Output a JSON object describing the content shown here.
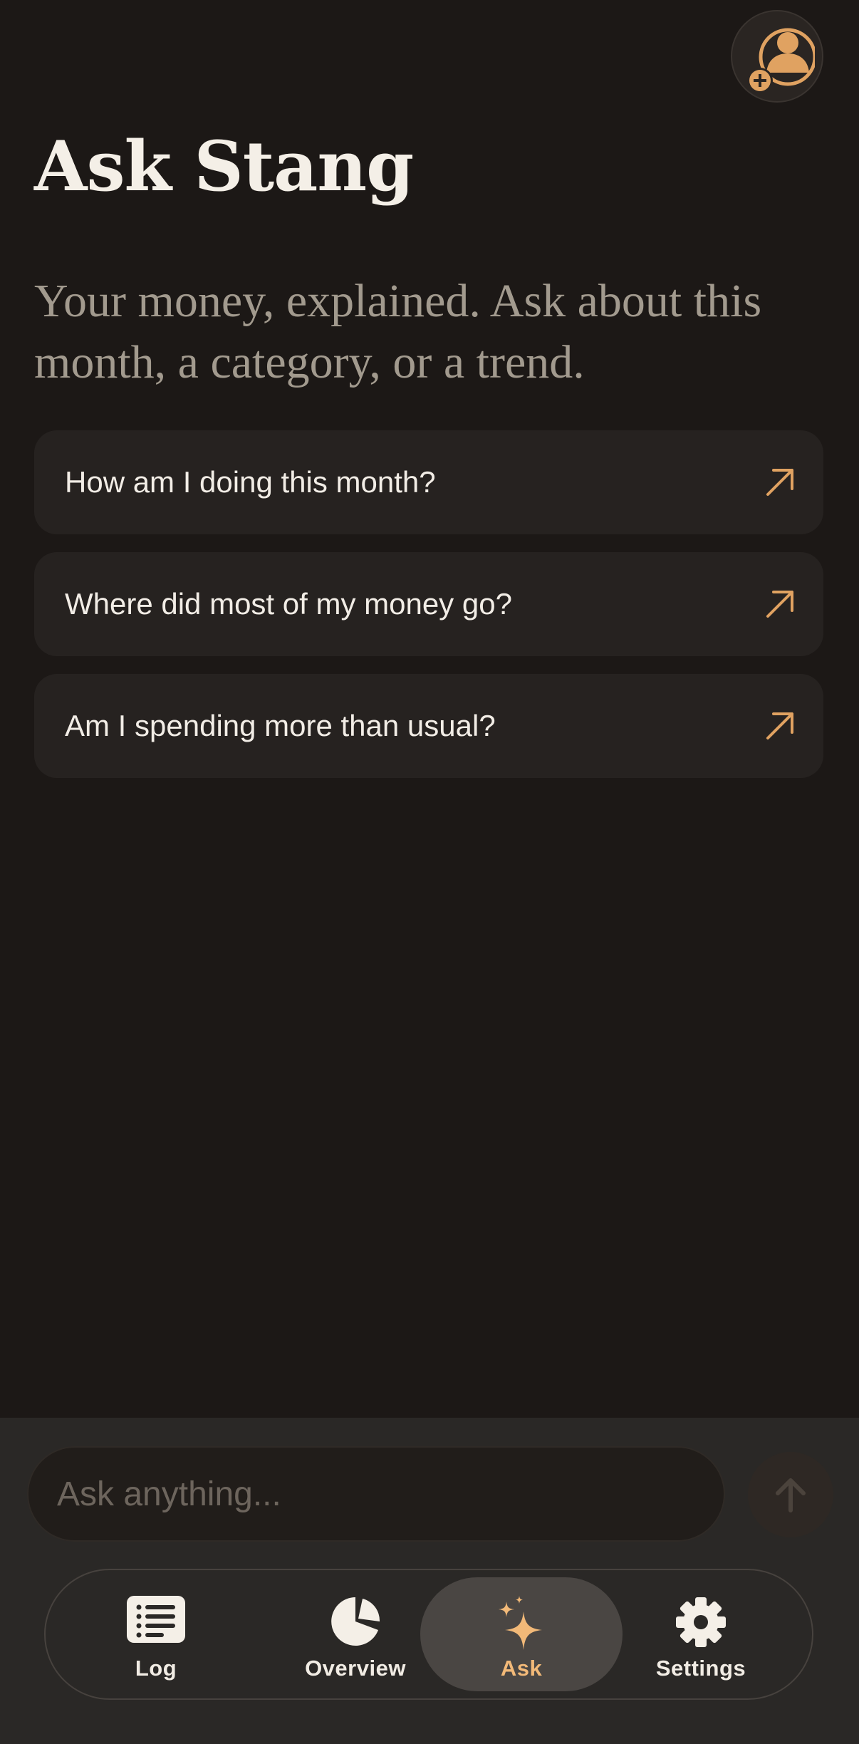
{
  "colors": {
    "accent": "#e0a261",
    "background": "#1c1816",
    "card": "#262220",
    "active_tab": "#f2b978"
  },
  "header": {
    "profile_icon": "add-user-icon",
    "title": "Ask Stang",
    "subtitle": "Your money, explained. Ask about this month, a category, or a trend."
  },
  "suggestions": [
    {
      "label": "How am I doing this month?",
      "icon": "arrow-up-right-icon"
    },
    {
      "label": "Where did most of my money go?",
      "icon": "arrow-up-right-icon"
    },
    {
      "label": "Am I spending more than usual?",
      "icon": "arrow-up-right-icon"
    }
  ],
  "composer": {
    "placeholder": "Ask anything...",
    "send_icon": "arrow-up-icon"
  },
  "tabs": [
    {
      "label": "Log",
      "icon": "list-icon",
      "active": false
    },
    {
      "label": "Overview",
      "icon": "pie-chart-icon",
      "active": false
    },
    {
      "label": "Ask",
      "icon": "sparkles-icon",
      "active": true
    },
    {
      "label": "Settings",
      "icon": "gear-icon",
      "active": false
    }
  ]
}
